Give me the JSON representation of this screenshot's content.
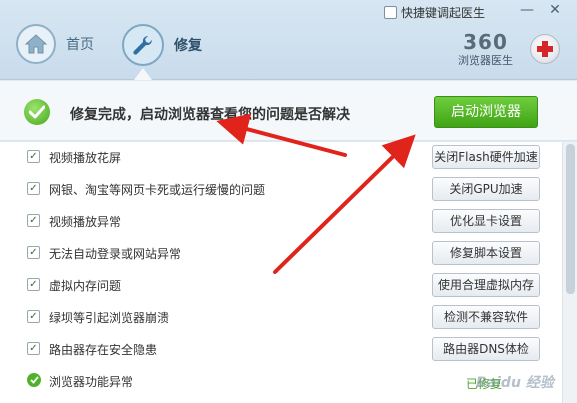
{
  "window": {
    "shortcut_label": "快捷键调起医生",
    "minimize_glyph": "—",
    "close_glyph": "✕"
  },
  "nav": {
    "home_label": "首页",
    "repair_label": "修复"
  },
  "brand": {
    "number": "360",
    "subtitle": "浏览器医生"
  },
  "status": {
    "message": "修复完成，启动浏览器查看您的问题是否解决",
    "launch_button": "启动浏览器"
  },
  "items": [
    {
      "label": "视频播放花屏",
      "action": "关闭Flash硬件加速",
      "checked": true
    },
    {
      "label": "网银、淘宝等网页卡死或运行缓慢的问题",
      "action": "关闭GPU加速",
      "checked": true
    },
    {
      "label": "视频播放异常",
      "action": "优化显卡设置",
      "checked": true
    },
    {
      "label": "无法自动登录或网站异常",
      "action": "修复脚本设置",
      "checked": true
    },
    {
      "label": "虚拟内存问题",
      "action": "使用合理虚拟内存",
      "checked": true
    },
    {
      "label": "绿坝等引起浏览器崩溃",
      "action": "检测不兼容软件",
      "checked": true
    },
    {
      "label": "路由器存在安全隐患",
      "action": "路由器DNS体检",
      "checked": true
    },
    {
      "label": "浏览器功能异常",
      "action": "已修复",
      "checked": true
    }
  ],
  "watermark": "Baidu 经验",
  "colors": {
    "accent_green": "#46a81f",
    "arrow_red": "#e0231b",
    "header_blue": "#c9dcec"
  },
  "icons": {
    "home": "home-icon",
    "repair": "wrench-icon",
    "status_ok": "check-circle-icon",
    "brand": "medical-cross-icon"
  }
}
